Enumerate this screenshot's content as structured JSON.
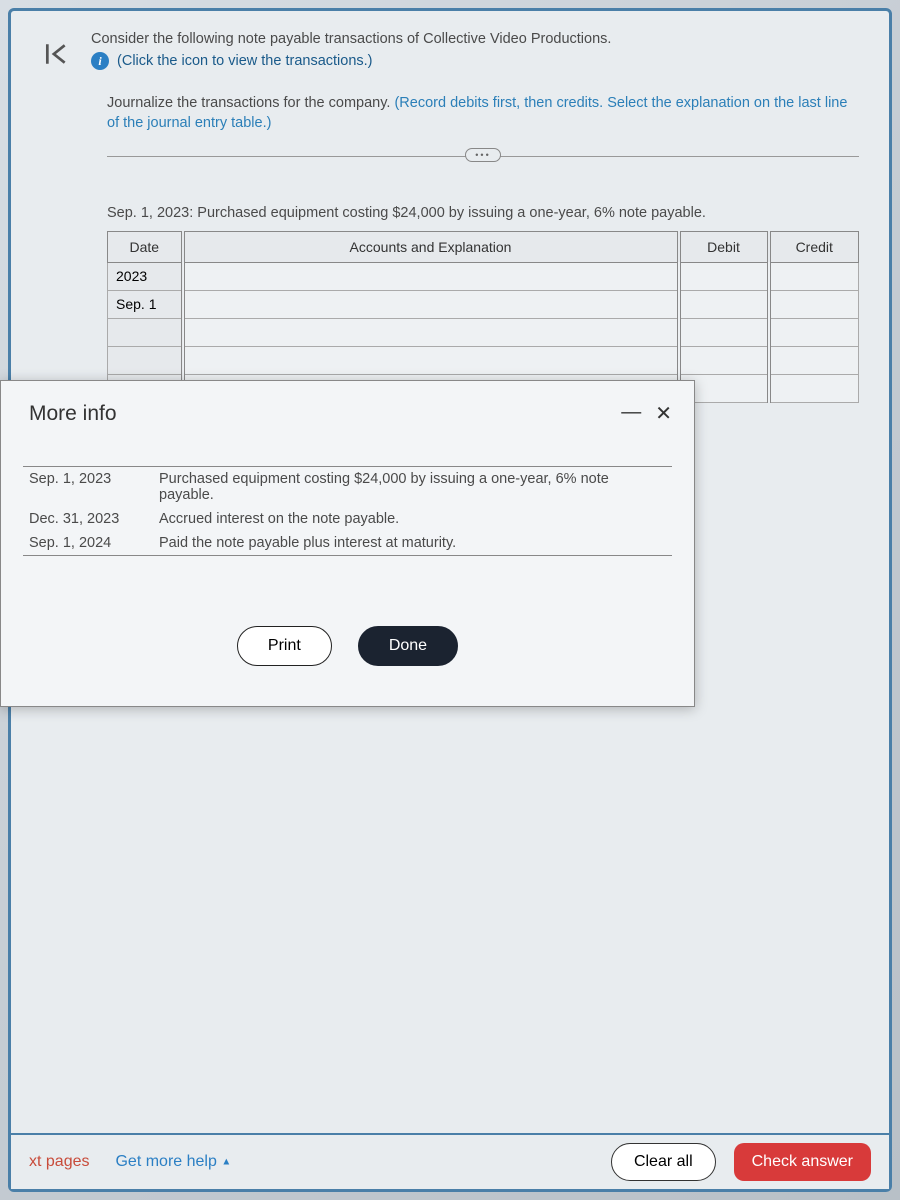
{
  "intro": {
    "line1": "Consider the following note payable transactions of Collective Video Productions.",
    "icon_hint": "(Click the icon to view the transactions.)"
  },
  "instruction": {
    "prefix": "Journalize the transactions for the company. ",
    "blue": "(Record debits first, then credits. Select the explanation on the last line of the journal entry table.)"
  },
  "entry": {
    "label": "Sep. 1, 2023: Purchased equipment costing $24,000 by issuing a one-year, 6% note payable.",
    "headers": {
      "date": "Date",
      "accounts": "Accounts and Explanation",
      "debit": "Debit",
      "credit": "Credit"
    },
    "year": "2023",
    "day": "Sep. 1"
  },
  "modal": {
    "title": "More info",
    "rows": [
      {
        "date": "Sep. 1, 2023",
        "desc": "Purchased equipment costing $24,000 by issuing a one-year, 6% note payable."
      },
      {
        "date": "Dec. 31, 2023",
        "desc": "Accrued interest on the note payable."
      },
      {
        "date": "Sep. 1, 2024",
        "desc": "Paid the note payable plus interest at maturity."
      }
    ],
    "print": "Print",
    "done": "Done"
  },
  "bottom": {
    "xt": "xt pages",
    "help": "Get more help",
    "clear": "Clear all",
    "check": "Check answer"
  }
}
